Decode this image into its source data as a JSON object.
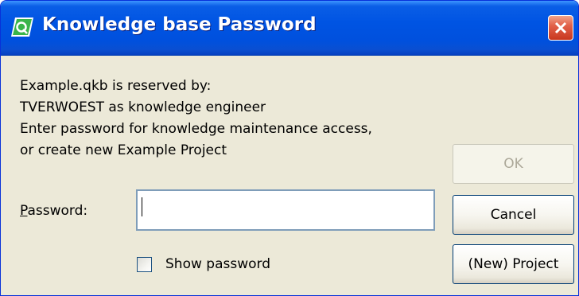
{
  "window": {
    "title": "Knowledge base Password"
  },
  "message": {
    "line1": "Example.qkb is reserved by:",
    "line2": "TVERWOEST  as knowledge engineer",
    "line3": "Enter password for knowledge maintenance access,",
    "line4": "or create new Example Project"
  },
  "password": {
    "label_mnemonic": "P",
    "label_rest": "assword:",
    "value": ""
  },
  "show_password": {
    "label": "Show password",
    "checked": false
  },
  "buttons": {
    "ok": "OK",
    "cancel": "Cancel",
    "project": "(New) Project"
  },
  "colors": {
    "titlebar": "#0054e3",
    "dialog_bg": "#ece9d8",
    "close_button": "#e2614a",
    "app_icon": "#3ab54a"
  },
  "icons": {
    "app": "qlikview-logo-icon",
    "close": "close-icon"
  }
}
